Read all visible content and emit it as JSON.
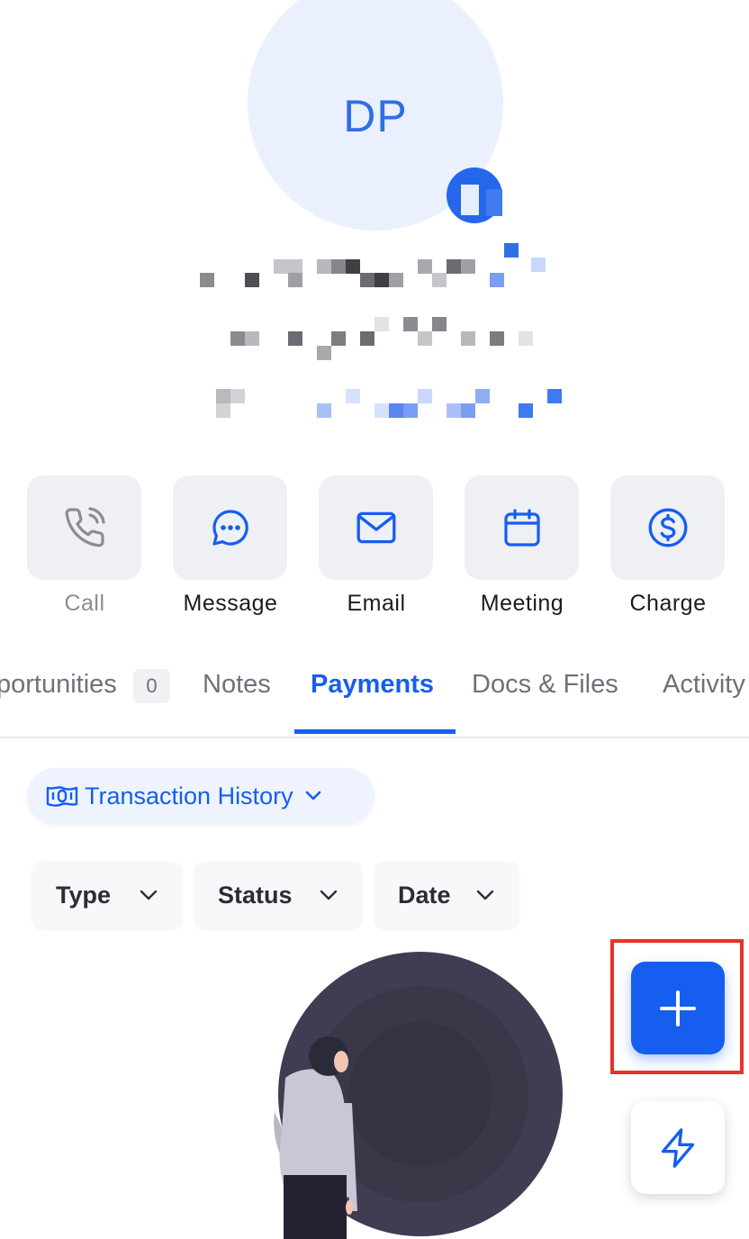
{
  "contact": {
    "initials": "DP"
  },
  "actions": [
    {
      "label": "Call",
      "icon": "phone-icon"
    },
    {
      "label": "Message",
      "icon": "message-icon"
    },
    {
      "label": "Email",
      "icon": "email-icon"
    },
    {
      "label": "Meeting",
      "icon": "calendar-icon"
    },
    {
      "label": "Charge",
      "icon": "dollar-icon"
    }
  ],
  "tabs": {
    "opportunities": "portunities",
    "opportunities_count": "0",
    "notes": "Notes",
    "payments": "Payments",
    "docs": "Docs & Files",
    "activity": "Activity",
    "active": "Payments"
  },
  "transaction_dropdown": {
    "label": "Transaction History",
    "icon": "money-icon"
  },
  "filters": [
    {
      "label": "Type"
    },
    {
      "label": "Status"
    },
    {
      "label": "Date"
    }
  ],
  "fab": {
    "add_icon": "plus-icon",
    "quick_icon": "lightning-icon"
  },
  "colors": {
    "accent": "#155eef",
    "highlight": "#e8322a"
  }
}
